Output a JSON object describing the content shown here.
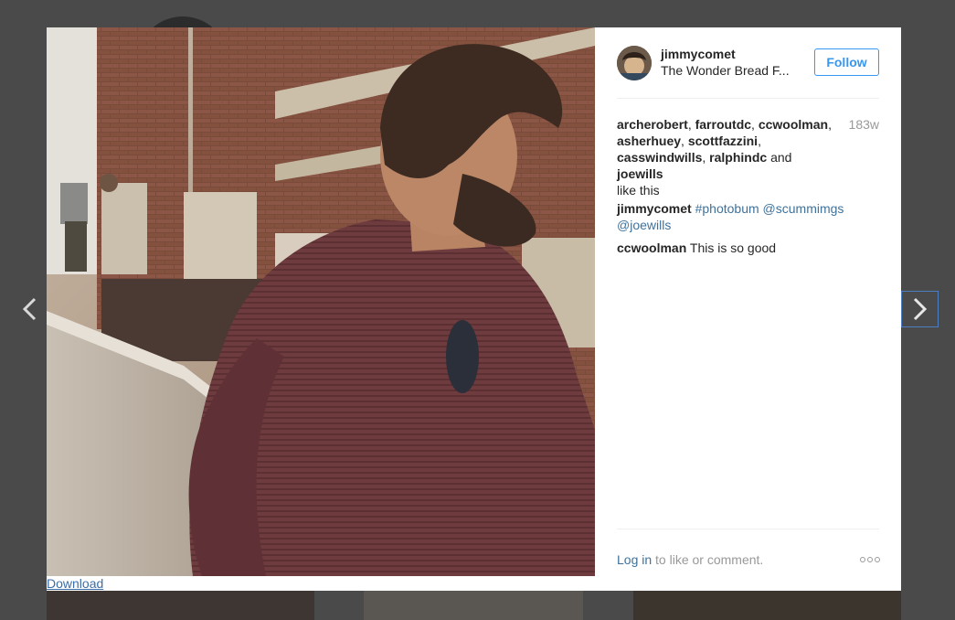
{
  "post": {
    "username": "jimmycomet",
    "location": "The Wonder Bread F...",
    "follow_label": "Follow",
    "time_ago": "183w",
    "likes": {
      "names": [
        "archerobert",
        "farroutdc",
        "ccwoolman",
        "asherhuey",
        "scottfazzini",
        "casswindwills",
        "ralphindc"
      ],
      "and_label": "and",
      "last_name": "joewills",
      "suffix": "like this"
    },
    "caption": {
      "username": "jimmycomet",
      "tags": [
        "#photobum",
        "@scummimgs",
        "@joewills"
      ]
    },
    "comments": [
      {
        "username": "ccwoolman",
        "text": "This is so good"
      }
    ],
    "login_link": "Log in",
    "login_suffix": "to like or comment.",
    "download_label": "Download"
  },
  "icons": {
    "prev": "chevron-left-icon",
    "next": "chevron-right-icon",
    "more": "more-dots-icon"
  },
  "colors": {
    "link": "#3f729b",
    "follow": "#3897f0",
    "muted": "#999999",
    "overlay": "#4a4a4a"
  }
}
